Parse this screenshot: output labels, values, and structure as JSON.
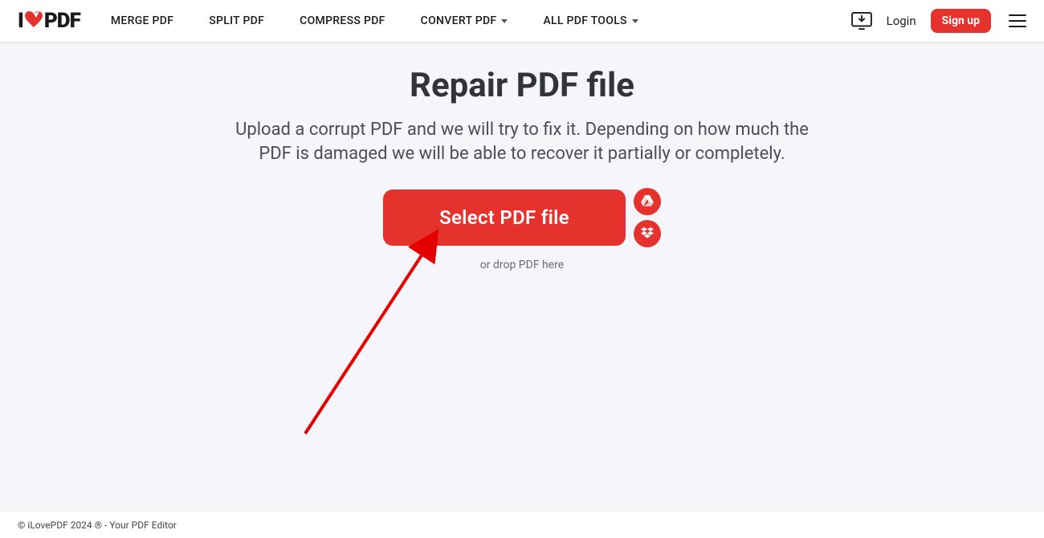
{
  "brand": {
    "pre": "I",
    "post": "PDF"
  },
  "nav": {
    "merge": "MERGE PDF",
    "split": "SPLIT PDF",
    "compress": "COMPRESS PDF",
    "convert": "CONVERT PDF",
    "all": "ALL PDF TOOLS"
  },
  "auth": {
    "login": "Login",
    "signup": "Sign up"
  },
  "page": {
    "title": "Repair PDF file",
    "subtitle": "Upload a corrupt PDF and we will try to fix it. Depending on how much the PDF is damaged we will be able to recover it partially or completely.",
    "select_label": "Select PDF file",
    "drop_hint": "or drop PDF here"
  },
  "footer": {
    "text": "© iLovePDF 2024 ® - Your PDF Editor"
  },
  "colors": {
    "accent": "#e5322d"
  }
}
